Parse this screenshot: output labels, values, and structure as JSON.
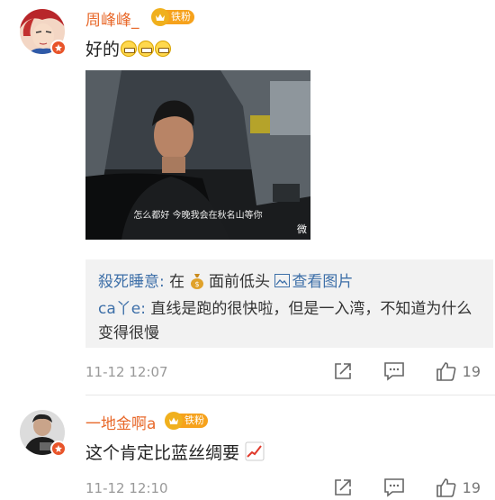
{
  "comments": [
    {
      "username": "周峰峰_",
      "fan_badge": "铁粉",
      "text": "好的",
      "emoji_count": 3,
      "video": {
        "subtitle": "怎么都好 今晚我会在秋名山等你",
        "watermark": "微"
      },
      "replies": [
        {
          "name": "殺死睡意:",
          "text_before": "在",
          "text_after": "面前低头",
          "link": "查看图片"
        },
        {
          "name": "ca丫e:",
          "text": "直线是跑的很快啦，但是一入湾，不知道为什么变得很慢"
        }
      ],
      "time": "11-12 12:07",
      "likes": "19"
    },
    {
      "username": "一地金啊a",
      "fan_badge": "铁粉",
      "text": "这个肯定比蓝丝绸要",
      "time": "11-12 12:10",
      "likes": "19"
    }
  ],
  "colors": {
    "username": "#e8692b",
    "reply_name": "#3d6fa8",
    "badge": "#f6a21c"
  }
}
